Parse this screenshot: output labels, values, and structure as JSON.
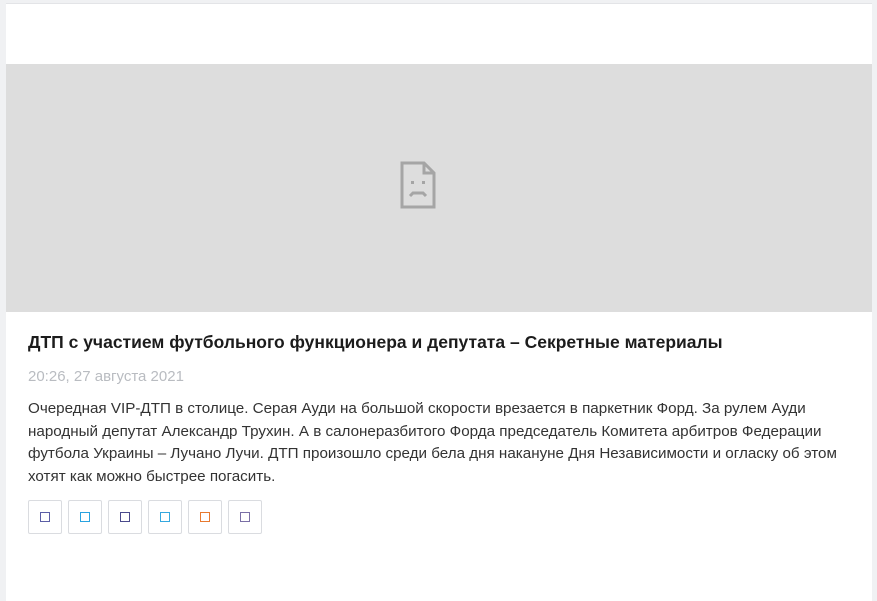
{
  "article": {
    "title": "ДТП с участием футбольного функционера и депутата – Секретные материалы",
    "date": "20:26, 27 августа 2021",
    "description": "Очередная VIP-ДТП в столице. Серая Ауди на большой скорости врезается в паркетник Форд. За рулем Ауди народный депутат Александр Трухин. А в салонеразбитого Форда председатель Комитета арбитров Федерации футбола Украины – Лучано Лучи. ДТП произошло среди бела дня накануне Дня Независимости и огласку об этом хотят как можно быстрее погасить.",
    "media": {
      "icon": "broken-image-icon"
    }
  },
  "share_buttons": [
    {
      "icon": "share-icon-1",
      "color": "#5b5ea6"
    },
    {
      "icon": "share-icon-2",
      "color": "#2aa3e0"
    },
    {
      "icon": "share-icon-3",
      "color": "#4a4a8c"
    },
    {
      "icon": "share-icon-4",
      "color": "#35a8df"
    },
    {
      "icon": "share-icon-5",
      "color": "#e8792f"
    },
    {
      "icon": "share-icon-6",
      "color": "#7a6fa6"
    }
  ],
  "colors": {
    "media_placeholder": "#dddddd",
    "title": "#1c1c1c",
    "date": "#b9bcc1",
    "text": "#333333"
  }
}
